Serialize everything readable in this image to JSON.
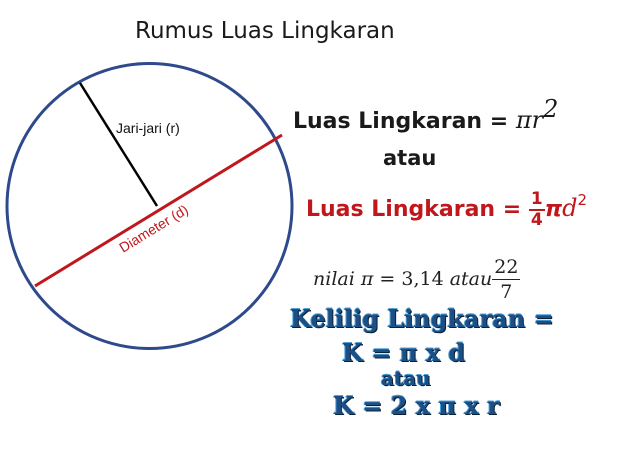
{
  "title": "Rumus Luas Lingkaran",
  "circle": {
    "radius_label": "Jari-jari (r)",
    "diameter_label": "Diameter (d)",
    "colors": {
      "circle": "#2e4a8c",
      "radius": "#000000",
      "diameter": "#c0171c"
    }
  },
  "formula1": {
    "label": "Luas Lingkaran",
    "equals": "=",
    "expr": "πr",
    "exponent": "2"
  },
  "atau1": "atau",
  "formula2": {
    "label": "Luas Lingkaran",
    "equals": "=",
    "frac_num": "1",
    "frac_den": "4",
    "pi": "π",
    "var": "d",
    "exponent": "2"
  },
  "pi_value": {
    "prefix": "nilai",
    "pi": "π",
    "equals": "=",
    "value": "3,14",
    "or": "atau",
    "frac_num": "22",
    "frac_den": "7"
  },
  "keliling": {
    "line1": "Kelilig Lingkaran =",
    "line2": "K = π x d",
    "line3": "atau",
    "line4": "K = 2 x π x r"
  }
}
